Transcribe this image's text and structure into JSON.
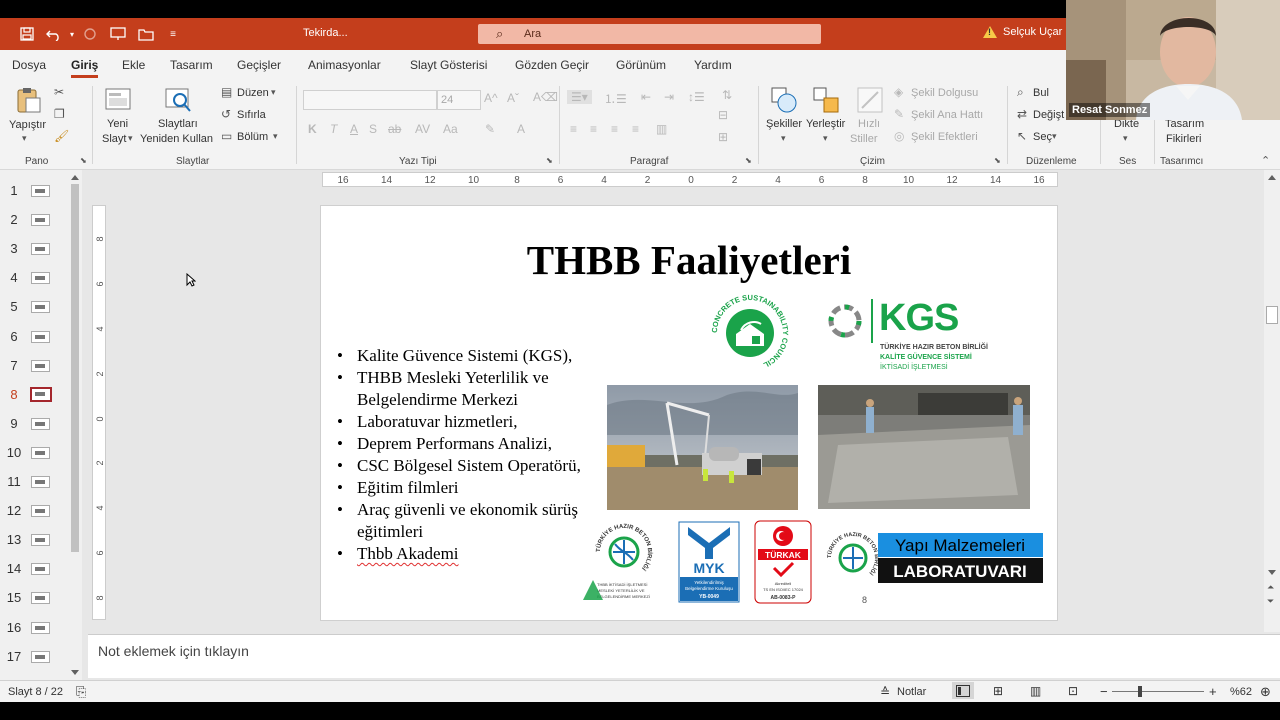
{
  "titlebar": {
    "doc_title": "Tekirda...",
    "search_placeholder": "Ara",
    "user_name": "Selçuk Uçar"
  },
  "tabs": [
    "Dosya",
    "Giriş",
    "Ekle",
    "Tasarım",
    "Geçişler",
    "Animasyonlar",
    "Slayt Gösterisi",
    "Gözden Geçir",
    "Görünüm",
    "Yardım"
  ],
  "active_tab": "Giriş",
  "ribbon": {
    "groups": {
      "pano": "Pano",
      "slaytlar": "Slaytlar",
      "yazi_tipi": "Yazı Tipi",
      "paragraf": "Paragraf",
      "cizim": "Çizim",
      "duzenleme": "Düzenleme",
      "ses": "Ses",
      "tasarimci": "Tasarımcı"
    },
    "paste": "Yapıştır",
    "new_slide_1": "Yeni",
    "new_slide_2": "Slayt",
    "reuse_1": "Slaytları",
    "reuse_2": "Yeniden Kullan",
    "layout": "Düzen",
    "reset": "Sıfırla",
    "section": "Bölüm",
    "font_size": "24",
    "bold": "K",
    "italic": "T",
    "underline": "A",
    "shadow": "S",
    "strike": "ab",
    "shapes": "Şekiller",
    "arrange": "Yerleştir",
    "quick_1": "Hızlı",
    "quick_2": "Stiller",
    "fill": "Şekil Dolgusu",
    "outline": "Şekil Ana Hattı",
    "effects": "Şekil Efektleri",
    "find": "Bul",
    "replace": "Değişt",
    "select": "Seç",
    "dictate": "Dikte",
    "designer_1": "Tasarım",
    "designer_2": "Fikirleri"
  },
  "thumbnails": [
    "1",
    "2",
    "3",
    "4",
    "5",
    "6",
    "7",
    "8",
    "9",
    "10",
    "11",
    "12",
    "13",
    "14",
    "15",
    "16",
    "17"
  ],
  "active_slide": "8",
  "ruler": {
    "h": [
      "16",
      "14",
      "12",
      "10",
      "8",
      "6",
      "4",
      "2",
      "0",
      "2",
      "4",
      "6",
      "8",
      "10",
      "12",
      "14",
      "16"
    ],
    "v": [
      "8",
      "6",
      "4",
      "2",
      "0",
      "2",
      "4",
      "6",
      "8"
    ]
  },
  "slide": {
    "title": "THBB Faaliyetleri",
    "bullets": [
      "Kalite Güvence Sistemi (KGS),",
      "THBB Mesleki Yeterlilik ve Belgelendirme Merkezi",
      "Laboratuvar hizmetleri,",
      "Deprem Performans Analizi,",
      "CSC Bölgesel Sistem Operatörü,",
      "Eğitim filmleri",
      "Araç güvenli ve ekonomik sürüş eğitimleri",
      "Thbb Akademi"
    ],
    "number": "8",
    "kgs": {
      "name": "KGS",
      "line1": "TÜRKİYE HAZIR BETON BİRLİĞİ",
      "line2": "KALİTE GÜVENCE SİSTEMİ",
      "line3": "İKTİSADİ İŞLETMESİ"
    },
    "csc_ring": "CONCRETE SUSTAINABILITY COUNCIL",
    "myk": {
      "name": "MYK",
      "sub1": "Yetkilendirilmiş",
      "sub2": "Belgelendirme Kuruluşu",
      "code": "YB-0049"
    },
    "turkak": {
      "name": "TÜRKAK",
      "line1": "Akrediteli",
      "line2": "TS EN ISO/IEC 17024",
      "code": "AB-0083-P"
    },
    "lab": {
      "line1": "Yapı Malzemeleri",
      "line2": "LABORATUVARI"
    },
    "thbb_small": {
      "line1": "THBB İKTİSADİ İŞLETMESİ",
      "line2": "MESLEKİ YETERLİLİK VE",
      "line3": "BELGELENDİRME MERKEZİ"
    },
    "ring_text": "TÜRKİYE HAZIR BETON BİRLİĞİ"
  },
  "notes_placeholder": "Not eklemek için tıklayın",
  "statusbar": {
    "slide_info": "Slayt 8 / 22",
    "notes": "Notlar",
    "zoom": "%62"
  },
  "webcam": {
    "name": "Resat Sonmez"
  },
  "colors": {
    "accent": "#c43e1c",
    "kgs_green": "#1aa34a",
    "myk_blue": "#1b6eb5",
    "lab_blue": "#1a8fe0"
  }
}
